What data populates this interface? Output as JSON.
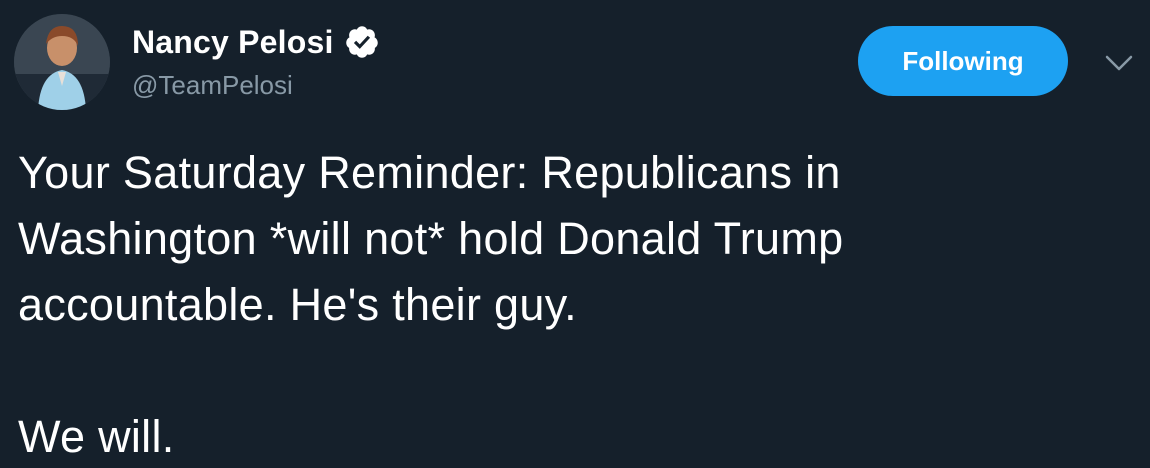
{
  "author": {
    "display_name": "Nancy Pelosi",
    "handle": "@TeamPelosi",
    "verified": true,
    "avatar_icon": "profile-photo"
  },
  "actions": {
    "follow_label": "Following",
    "menu_icon": "chevron-down-icon"
  },
  "tweet": {
    "paragraph_1": "Your Saturday Reminder: Republicans in\nWashington *will not* hold Donald Trump\naccountable. He's their guy.",
    "paragraph_2": "We will."
  },
  "colors": {
    "background": "#15202b",
    "accent": "#1da1f2",
    "secondary_text": "#8899a6"
  }
}
